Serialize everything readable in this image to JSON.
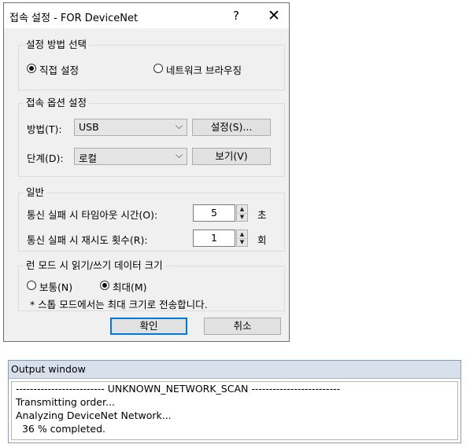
{
  "dialog": {
    "title": "접속 설정 - FOR DeviceNet",
    "help_label": "?",
    "close_label": "✕",
    "method_group": {
      "legend": "설정 방법 선택",
      "options": [
        {
          "label": "직접 설정",
          "checked": true
        },
        {
          "label": "네트워크 브라우징",
          "checked": false
        }
      ]
    },
    "connection_group": {
      "legend": "접속 옵션 설정",
      "method_label": "방법(T):",
      "method_value": "USB",
      "settings_button": "설정(S)...",
      "stage_label": "단계(D):",
      "stage_value": "로컬",
      "view_button": "보기(V)"
    },
    "general_group": {
      "legend": "일반",
      "timeout_label": "통신 실패 시 타임아웃 시간(O):",
      "timeout_value": "5",
      "timeout_unit": "초",
      "retry_label": "통신 실패 시 재시도 횟수(R):",
      "retry_value": "1",
      "retry_unit": "회"
    },
    "run_mode_group": {
      "legend": "런 모드 시 읽기/쓰기 데이터 크기",
      "options": [
        {
          "label": "보통(N)",
          "checked": false
        },
        {
          "label": "최대(M)",
          "checked": true
        }
      ],
      "note": "* 스톱 모드에서는 최대 크기로 전송합니다."
    },
    "ok_button": "확인",
    "cancel_button": "취소"
  },
  "output_window": {
    "title": "Output window",
    "lines": [
      "------------------------- UNKNOWN_NETWORK_SCAN -------------------------",
      "Transmitting order...",
      "Analyzing DeviceNet Network...",
      "  36 % completed."
    ]
  }
}
